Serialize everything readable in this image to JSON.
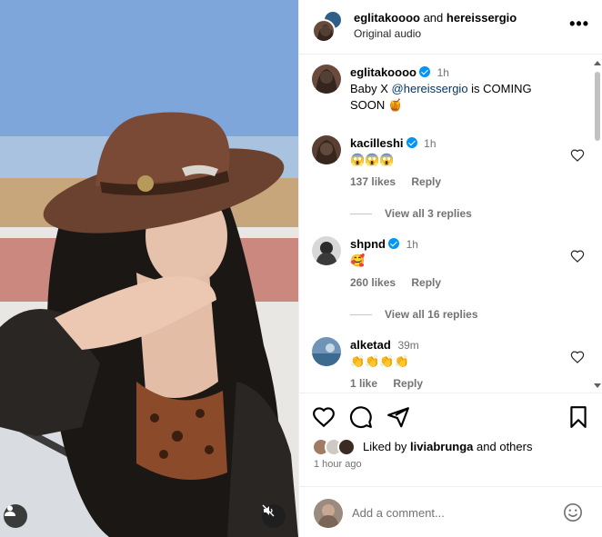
{
  "header": {
    "user1": "eglitakoooo",
    "joiner": "and",
    "user2": "hereissergio",
    "subtitle": "Original audio",
    "more": "•••"
  },
  "comments": [
    {
      "user": "eglitakoooo",
      "verified": true,
      "time": "1h",
      "text_before": "Baby X ",
      "mention": "@hereissergio",
      "text_after": " is COMING SOON 🍯"
    },
    {
      "user": "kacilleshi",
      "verified": true,
      "time": "1h",
      "text": "😱😱😱",
      "likes": "137 likes",
      "reply": "Reply",
      "view_replies": "View all 3 replies"
    },
    {
      "user": "shpnd",
      "verified": true,
      "time": "1h",
      "text": "🥰",
      "likes": "260 likes",
      "reply": "Reply",
      "view_replies": "View all 16 replies"
    },
    {
      "user": "alketad",
      "verified": false,
      "time": "39m",
      "text": "👏👏👏👏",
      "likes": "1 like",
      "reply": "Reply"
    }
  ],
  "liked_by": {
    "prefix": "Liked by",
    "user": "liviabrunga",
    "suffix": "and others"
  },
  "timestamp": "1 hour ago",
  "add_comment": {
    "placeholder": "Add a comment..."
  },
  "icons": [
    "user-tag-icon",
    "muted-audio-icon",
    "heart-icon",
    "comment-icon",
    "share-icon",
    "save-icon",
    "emoji-icon",
    "more-icon"
  ],
  "colors": {
    "accent": "#0095f6",
    "mention": "#00376b",
    "muted_text": "#737373"
  }
}
